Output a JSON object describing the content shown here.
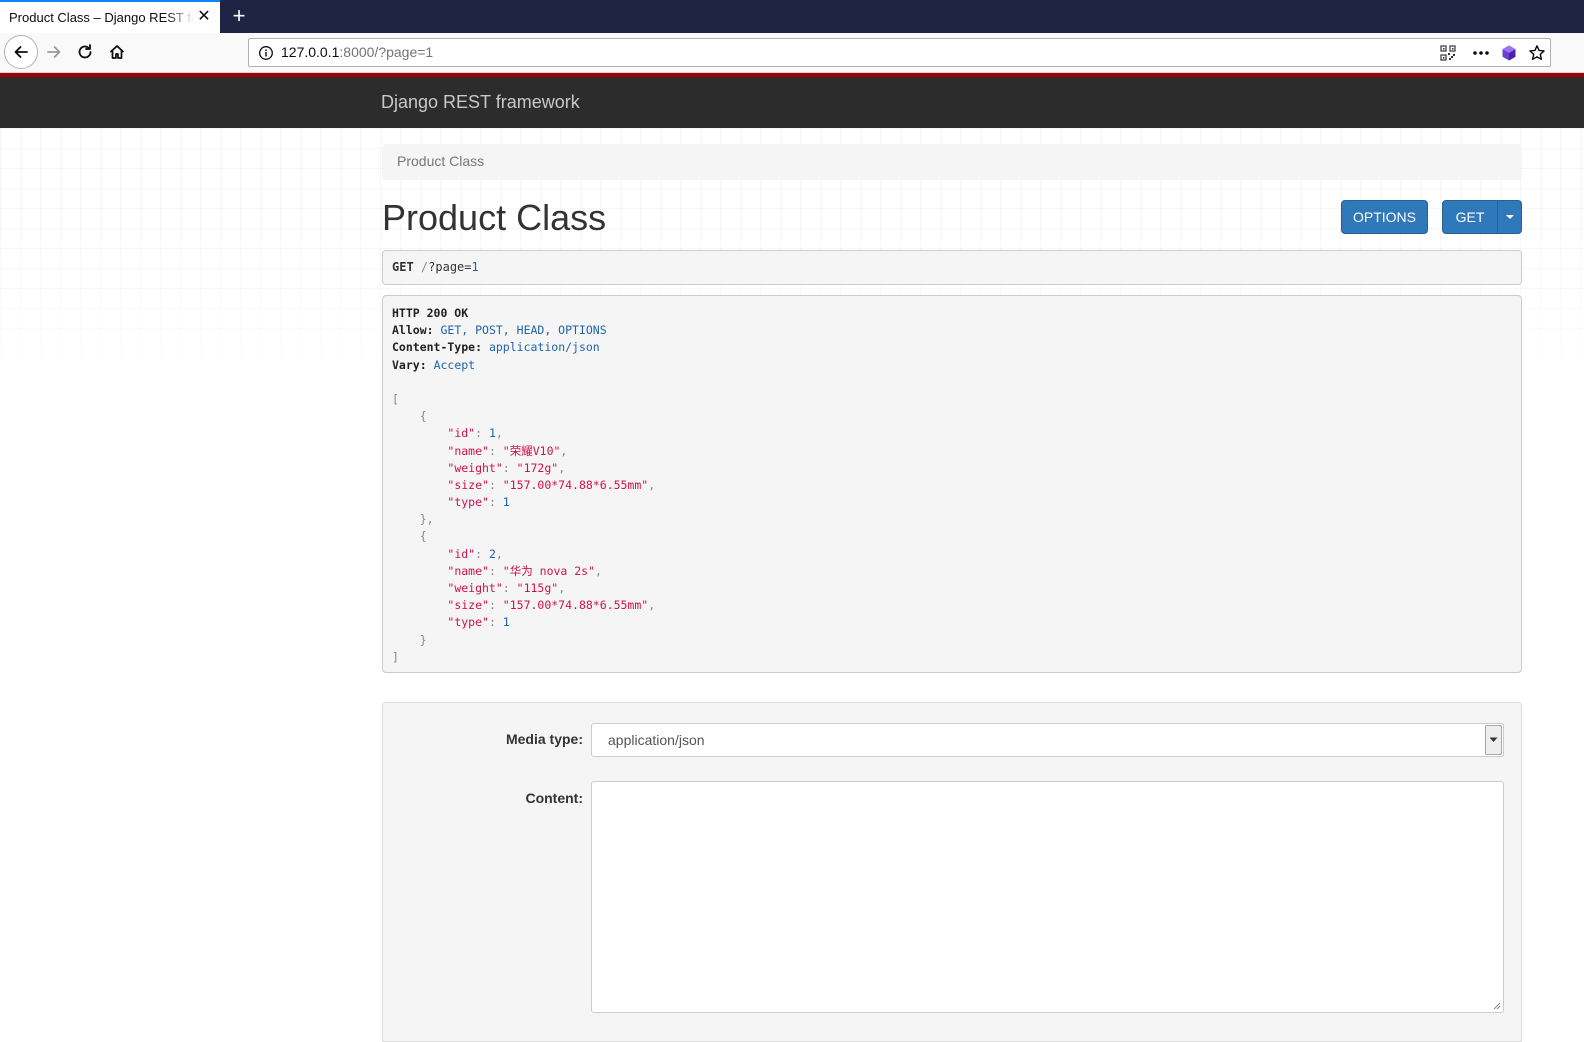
{
  "browser": {
    "tab_title": "Product Class – Django REST framework",
    "url_host": "127.0.0.1",
    "url_rest": ":8000/?page=1",
    "icons": [
      "back-icon",
      "forward-icon",
      "reload-icon",
      "home-icon",
      "info-icon",
      "qr-code-icon",
      "page-actions-icon",
      "extension-icon",
      "bookmark-star-icon",
      "close-icon",
      "new-tab-icon"
    ]
  },
  "navbar": {
    "brand": "Django REST framework"
  },
  "breadcrumb": {
    "current": "Product Class"
  },
  "page": {
    "title": "Product Class",
    "options_label": "OPTIONS",
    "get_label": "GET"
  },
  "request": {
    "method": "GET",
    "path_prefix": "/",
    "query_key": "?page=",
    "query_value": "1"
  },
  "response": {
    "status": "HTTP 200 OK",
    "headers": [
      {
        "name": "Allow:",
        "value": "GET, POST, HEAD, OPTIONS"
      },
      {
        "name": "Content-Type:",
        "value": "application/json"
      },
      {
        "name": "Vary:",
        "value": "Accept"
      }
    ],
    "items": [
      {
        "id": "1",
        "name": "\"荣耀V10\"",
        "weight": "\"172g\"",
        "size": "\"157.00*74.88*6.55mm\"",
        "type": "1"
      },
      {
        "id": "2",
        "name": "\"华为 nova 2s\"",
        "weight": "\"115g\"",
        "size": "\"157.00*74.88*6.55mm\"",
        "type": "1"
      }
    ],
    "keys": {
      "id": "\"id\"",
      "name": "\"name\"",
      "weight": "\"weight\"",
      "size": "\"size\"",
      "type": "\"type\""
    }
  },
  "form": {
    "media_type_label": "Media type:",
    "media_type_value": "application/json",
    "content_label": "Content:"
  },
  "colors": {
    "accent": "#2f79bb",
    "navbar": "#2c2c2c",
    "json_string": "#d0114e",
    "json_number": "#1e63a8"
  }
}
